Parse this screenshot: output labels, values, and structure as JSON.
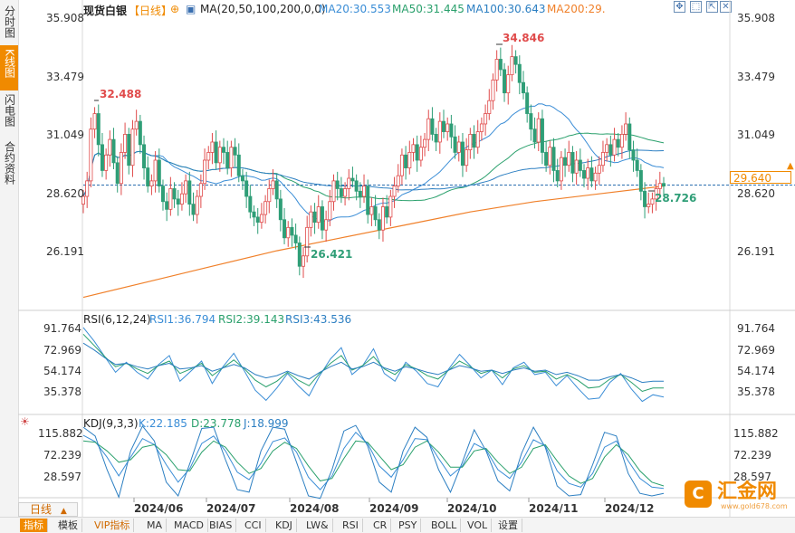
{
  "sidebar": {
    "tabs": [
      {
        "label": "分时图",
        "active": false
      },
      {
        "label": "K线图",
        "active": true
      },
      {
        "label": "闪电图",
        "active": false
      },
      {
        "label": "合约资料",
        "active": false
      }
    ]
  },
  "header": {
    "instrument": "现货白银",
    "period": "【日线】",
    "ma_label": "MA(20,50,100,200,0,0)",
    "ma20": "MA20:30.553",
    "ma50": "MA50:31.445",
    "ma100": "MA100:30.643",
    "ma200": "MA200:29."
  },
  "rsi_header": {
    "title": "RSI(6,12,24)",
    "rsi1": "RSI1:36.794",
    "rsi2": "RSI2:39.143",
    "rsi3": "RSI3:43.536"
  },
  "kdj_header": {
    "title": "KDJ(9,3,3)",
    "k": "K:22.185",
    "d": "D:23.778",
    "j": "J:18.999"
  },
  "annotations": {
    "high": "34.846",
    "early_high": "32.488",
    "low": "26.421",
    "recent_low": "28.726"
  },
  "current_price": "29.640",
  "period_selector": {
    "label": "日线",
    "arrow": "▲"
  },
  "bottom_tabs": [
    "指标",
    "模板",
    "VIP指标",
    "MA",
    "MACD",
    "BIAS",
    "CCI",
    "KDJ",
    "LW&",
    "RSI",
    "CR",
    "PSY",
    "BOLL",
    "VOL",
    "设置"
  ],
  "logo": {
    "mark": "C",
    "text": "汇金网",
    "url": "www.gold678.com"
  },
  "colors": {
    "up": "#e04b4b",
    "down": "#2f9e77",
    "ma20": "#3a8dd6",
    "ma50": "#2aa06c",
    "ma100": "#2c7fc2",
    "ma200": "#f0802a",
    "accent": "#f08a00"
  },
  "chart_data": [
    {
      "type": "candlestick",
      "yticks": [
        "35.908",
        "33.479",
        "31.049",
        "28.620",
        "26.191"
      ],
      "ylim": [
        24.9,
        36.3
      ],
      "xticks": [
        "2024/06",
        "2024/07",
        "2024/08",
        "2024/09",
        "2024/10",
        "2024/11",
        "2024/12"
      ],
      "current_price": 29.64,
      "closes": [
        29.2,
        29.8,
        31.8,
        32.4,
        31.2,
        30.2,
        30.8,
        31.4,
        30.5,
        29.7,
        30.9,
        31.6,
        30.4,
        31.8,
        32.1,
        31.2,
        30.3,
        29.6,
        29.8,
        30.6,
        29.6,
        29.0,
        28.7,
        29.5,
        29.1,
        28.9,
        29.3,
        29.8,
        28.9,
        28.5,
        29.2,
        29.7,
        30.6,
        30.9,
        31.3,
        30.5,
        31.1,
        30.9,
        30.3,
        31.1,
        30.8,
        30.0,
        29.8,
        29.2,
        28.6,
        28.4,
        28.2,
        28.5,
        29.0,
        29.5,
        29.8,
        29.1,
        28.3,
        27.6,
        28.0,
        27.7,
        27.4,
        26.5,
        26.9,
        28.0,
        28.6,
        28.2,
        28.8,
        27.9,
        28.3,
        29.0,
        29.8,
        29.5,
        29.2,
        29.5,
        29.9,
        29.8,
        29.4,
        29.2,
        29.6,
        28.5,
        28.8,
        28.3,
        27.9,
        28.8,
        28.4,
        29.2,
        29.6,
        30.0,
        30.8,
        30.3,
        30.9,
        31.2,
        30.6,
        31.1,
        31.4,
        32.2,
        31.6,
        31.3,
        32.1,
        31.7,
        32.0,
        31.5,
        30.9,
        31.3,
        30.4,
        31.0,
        31.6,
        31.1,
        31.7,
        32.0,
        32.4,
        32.9,
        33.7,
        34.5,
        34.1,
        33.2,
        33.9,
        34.6,
        34.3,
        33.6,
        33.2,
        32.4,
        31.8,
        31.3,
        32.2,
        30.9,
        30.4,
        31.1,
        30.2,
        29.8,
        30.7,
        30.4,
        30.9,
        30.1,
        30.6,
        30.2,
        29.9,
        30.3,
        29.8,
        30.1,
        30.4,
        30.9,
        31.2,
        30.8,
        31.4,
        31.1,
        31.6,
        32.0,
        31.0,
        30.6,
        30.2,
        29.4,
        28.8,
        28.9,
        29.1,
        29.5,
        29.7,
        29.6
      ],
      "ma200": [
        25.3,
        25.9,
        26.5,
        27.1,
        27.6,
        28.1,
        28.6,
        29.0,
        29.3,
        29.6
      ]
    },
    {
      "type": "line",
      "yticks": [
        "91.764",
        "72.969",
        "54.174",
        "35.378"
      ],
      "ylim": [
        16,
        100
      ],
      "series": [
        {
          "name": "RSI1",
          "values": [
            92,
            80,
            66,
            52,
            61,
            52,
            46,
            59,
            67,
            44,
            53,
            62,
            42,
            57,
            69,
            53,
            36,
            27,
            38,
            51,
            40,
            31,
            49,
            64,
            74,
            50,
            58,
            73,
            51,
            44,
            61,
            53,
            42,
            39,
            55,
            68,
            58,
            47,
            54,
            41,
            56,
            61,
            50,
            52,
            40,
            49,
            38,
            28,
            29,
            43,
            51,
            37,
            26,
            32,
            30
          ]
        },
        {
          "name": "RSI2",
          "values": [
            86,
            76,
            66,
            57,
            60,
            55,
            51,
            58,
            62,
            51,
            55,
            60,
            49,
            56,
            63,
            55,
            45,
            39,
            44,
            52,
            45,
            40,
            51,
            60,
            67,
            54,
            58,
            66,
            55,
            50,
            59,
            55,
            49,
            46,
            54,
            62,
            57,
            51,
            54,
            47,
            55,
            58,
            52,
            53,
            46,
            50,
            45,
            38,
            39,
            46,
            50,
            43,
            35,
            38,
            38
          ]
        },
        {
          "name": "RSI3",
          "values": [
            78,
            72,
            65,
            59,
            60,
            57,
            55,
            58,
            60,
            55,
            56,
            58,
            53,
            56,
            59,
            56,
            50,
            47,
            49,
            53,
            49,
            46,
            52,
            57,
            61,
            55,
            57,
            61,
            56,
            53,
            57,
            55,
            52,
            50,
            54,
            58,
            56,
            53,
            54,
            51,
            54,
            56,
            53,
            54,
            50,
            52,
            49,
            45,
            45,
            48,
            50,
            47,
            43,
            44,
            44
          ]
        }
      ]
    },
    {
      "type": "line",
      "yticks": [
        "115.882",
        "72.239",
        "28.597"
      ],
      "ylim": [
        8,
        124
      ],
      "series": [
        {
          "name": "K",
          "values": [
            105,
            95,
            70,
            40,
            70,
            100,
            90,
            58,
            30,
            52,
            92,
            104,
            80,
            46,
            34,
            60,
            95,
            101,
            78,
            38,
            18,
            40,
            84,
            110,
            92,
            56,
            38,
            66,
            100,
            98,
            68,
            40,
            56,
            92,
            82,
            50,
            36,
            62,
            98,
            88,
            48,
            28,
            22,
            44,
            86,
            96,
            64,
            36,
            22,
            20
          ]
        },
        {
          "name": "D",
          "values": [
            96,
            94,
            80,
            62,
            66,
            86,
            90,
            74,
            50,
            48,
            78,
            96,
            86,
            62,
            44,
            52,
            80,
            94,
            84,
            56,
            32,
            36,
            68,
            96,
            94,
            72,
            50,
            58,
            86,
            96,
            78,
            54,
            54,
            80,
            84,
            62,
            44,
            54,
            84,
            90,
            64,
            40,
            28,
            36,
            70,
            90,
            74,
            48,
            30,
            24
          ]
        },
        {
          "name": "J",
          "values": [
            118,
            104,
            50,
            6,
            80,
            120,
            96,
            30,
            8,
            60,
            116,
            118,
            66,
            18,
            14,
            80,
            118,
            115,
            62,
            8,
            4,
            50,
            112,
            121,
            88,
            30,
            14,
            80,
            118,
            102,
            50,
            14,
            62,
            114,
            80,
            32,
            16,
            76,
            118,
            86,
            24,
            8,
            10,
            58,
            110,
            104,
            44,
            12,
            8,
            12
          ]
        }
      ]
    }
  ]
}
